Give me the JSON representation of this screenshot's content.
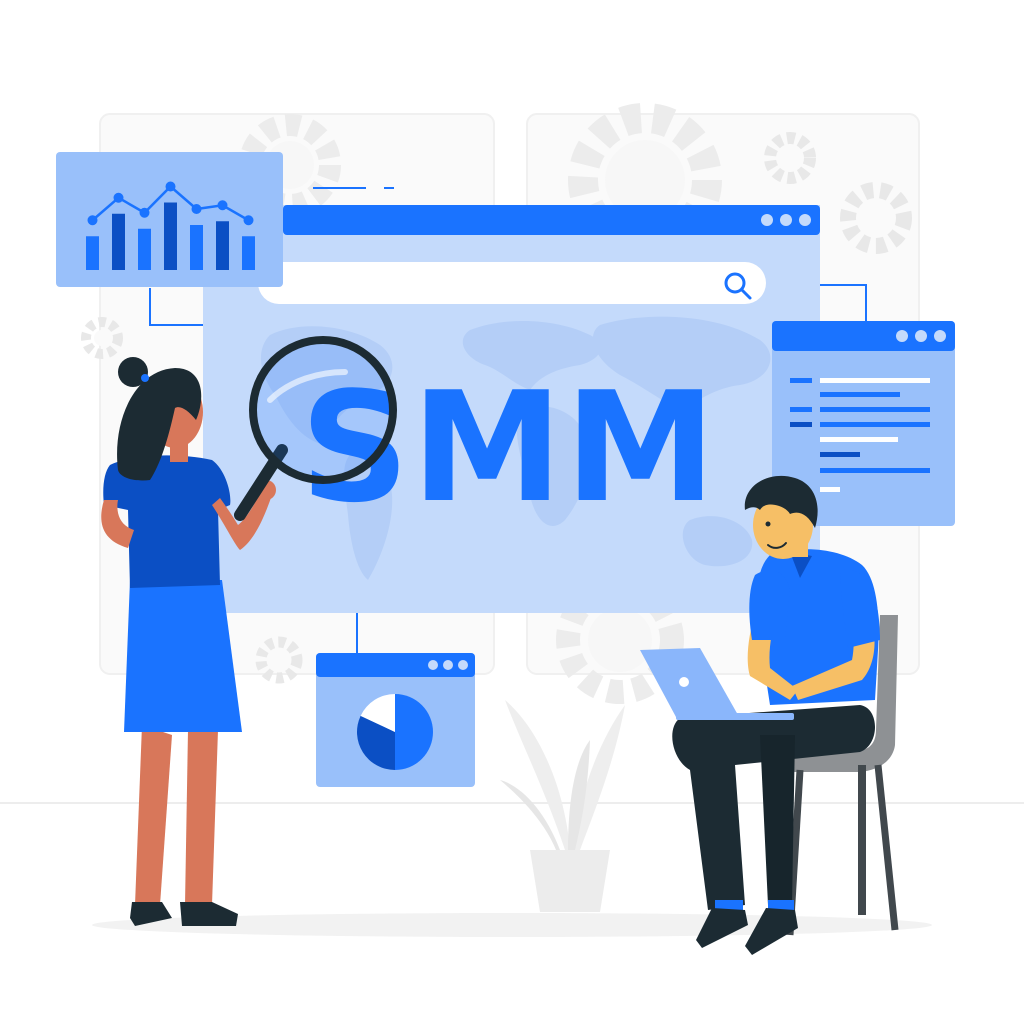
{
  "headline": {
    "text": "SMM"
  },
  "colors": {
    "brand_blue": "#1a73ff",
    "dark_blue": "#0b4fc4",
    "light_blue": "#c4dafb",
    "mid_blue": "#8ab6fb",
    "panel_blue": "#99c0fa",
    "skin": "#d8775a",
    "skin_light": "#f6bf66",
    "hair": "#1c2b33",
    "background_grey": "#f3f3f3",
    "chair_grey": "#8e9194"
  },
  "icons": [
    "search-icon",
    "magnifying-glass-icon",
    "bar-chart-icon",
    "line-chart-icon",
    "pie-chart-icon",
    "gear-icon",
    "laptop-icon",
    "world-map-icon",
    "plant-icon",
    "window-dots-icon"
  ],
  "bar_chart_widget": {
    "bar_levels": [
      0.45,
      0.75,
      0.55,
      0.9,
      0.6,
      0.65,
      0.45
    ]
  },
  "pie_chart_widget": {
    "slice_fractions": [
      0.5,
      0.32,
      0.18
    ]
  }
}
